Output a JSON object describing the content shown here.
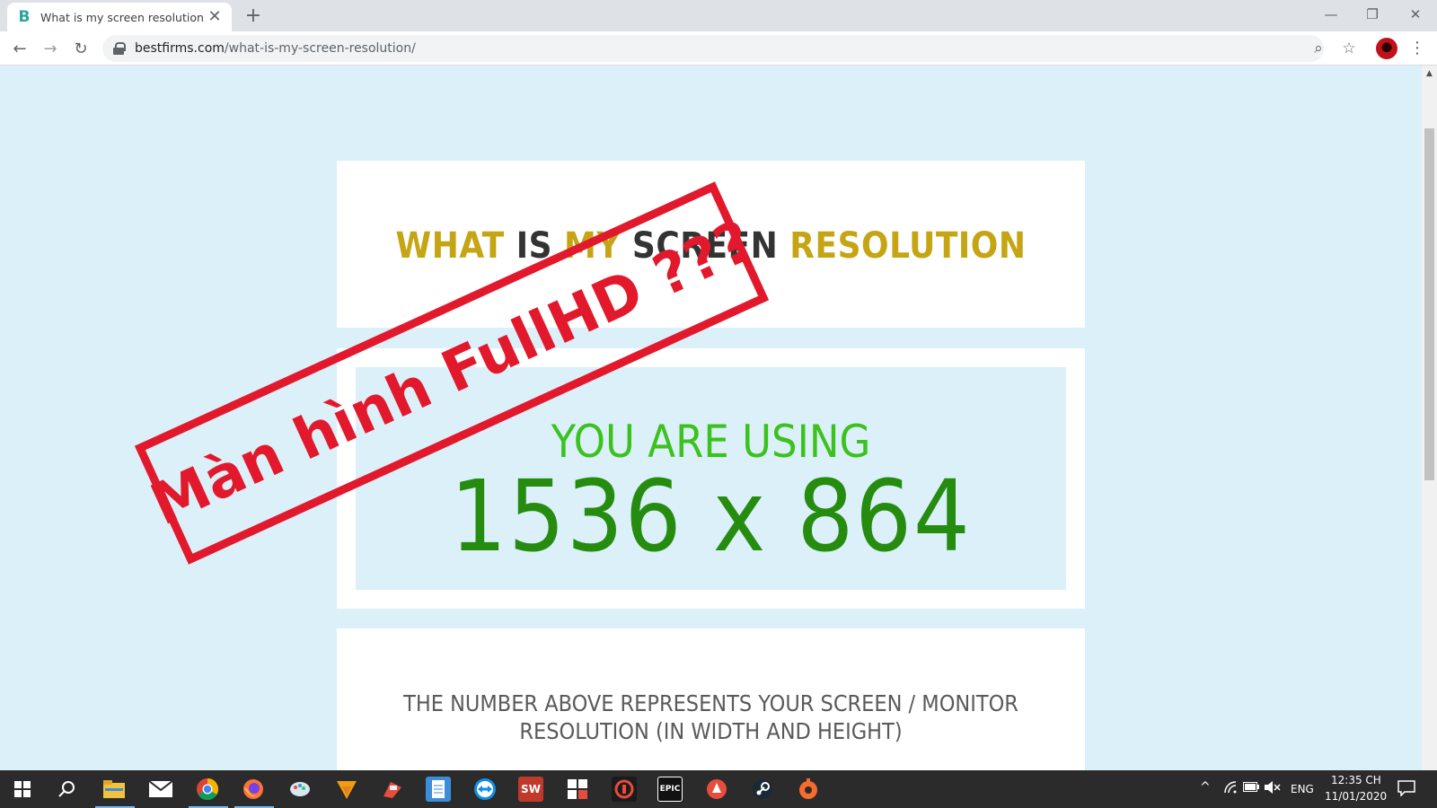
{
  "browser": {
    "tab_title": "What is my screen resolution",
    "tab_close": "✕",
    "new_tab": "+",
    "url_host": "bestfirms.com",
    "url_path": "/what-is-my-screen-resolution/",
    "icons": {
      "back": "←",
      "forward": "→",
      "reload": "↻",
      "zoom": "⌕",
      "star": "☆",
      "menu": "⋮",
      "minimize": "—",
      "restore": "❐",
      "close": "✕"
    }
  },
  "page": {
    "heading_words": [
      "WHAT",
      "IS",
      "MY",
      "SCREEN",
      "RESOLUTION"
    ],
    "using_label": "YOU ARE USING",
    "resolution": "1536 x 864",
    "info_text": "THE NUMBER ABOVE REPRESENTS YOUR SCREEN / MONITOR RESOLUTION (IN WIDTH AND HEIGHT)",
    "stamp_text": "Màn hình FullHD ???",
    "colors": {
      "background": "#dbf0f8",
      "heading_gold": "#c5a514",
      "heading_dark": "#333333",
      "using_green": "#3cc21f",
      "resolution_green": "#258c10",
      "stamp_red": "#e2192c"
    }
  },
  "taskbar": {
    "language": "ENG",
    "time": "12:35 CH",
    "date": "11/01/2020",
    "apps": [
      "file-explorer",
      "mail",
      "chrome",
      "firefox",
      "paint",
      "vlc",
      "app-red",
      "notepad",
      "teamviewer",
      "sw2016",
      "calculator",
      "garena",
      "epic-games",
      "game-app",
      "steam",
      "origin"
    ],
    "labels": {
      "sw": "SW",
      "epic": "EPIC"
    }
  }
}
